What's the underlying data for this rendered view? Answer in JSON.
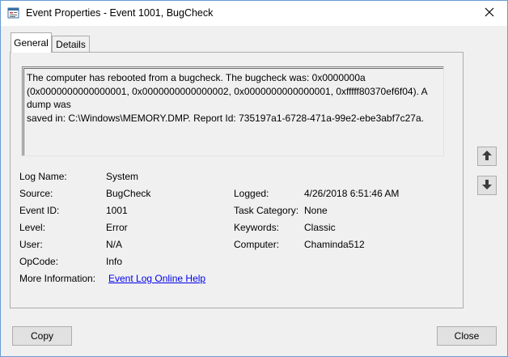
{
  "window": {
    "title": "Event Properties - Event 1001, BugCheck",
    "icon": "event-viewer-icon",
    "close_icon": "close-icon"
  },
  "tabs": [
    {
      "label": "General",
      "active": true
    },
    {
      "label": "Details",
      "active": false
    }
  ],
  "description": {
    "line1": "The computer has rebooted from a bugcheck.  The bugcheck was: 0x0000000a",
    "line2": "(0x0000000000000001, 0x0000000000000002, 0x0000000000000001, 0xfffff80370ef6f04). A dump was",
    "line3": "saved in: C:\\Windows\\MEMORY.DMP. Report Id: 735197a1-6728-471a-99e2-ebe3abf7c27a."
  },
  "fields": {
    "log_name": {
      "label": "Log Name:",
      "value": "System"
    },
    "source": {
      "label": "Source:",
      "value": "BugCheck"
    },
    "event_id": {
      "label": "Event ID:",
      "value": "1001"
    },
    "level": {
      "label": "Level:",
      "value": "Error"
    },
    "user": {
      "label": "User:",
      "value": "N/A"
    },
    "opcode": {
      "label": "OpCode:",
      "value": "Info"
    },
    "more_info": {
      "label": "More Information:",
      "value": "Event Log Online Help"
    },
    "logged": {
      "label": "Logged:",
      "value": "4/26/2018 6:51:46 AM"
    },
    "task_category": {
      "label": "Task Category:",
      "value": "None"
    },
    "keywords": {
      "label": "Keywords:",
      "value": "Classic"
    },
    "computer": {
      "label": "Computer:",
      "value": "Chaminda512"
    }
  },
  "scroll": {
    "up_icon": "arrow-up-icon",
    "down_icon": "arrow-down-icon"
  },
  "buttons": {
    "copy": "Copy",
    "close": "Close"
  },
  "colors": {
    "accent_border": "#6a9bd1",
    "link": "#0000ee",
    "window_bg": "#f0f0f0"
  }
}
